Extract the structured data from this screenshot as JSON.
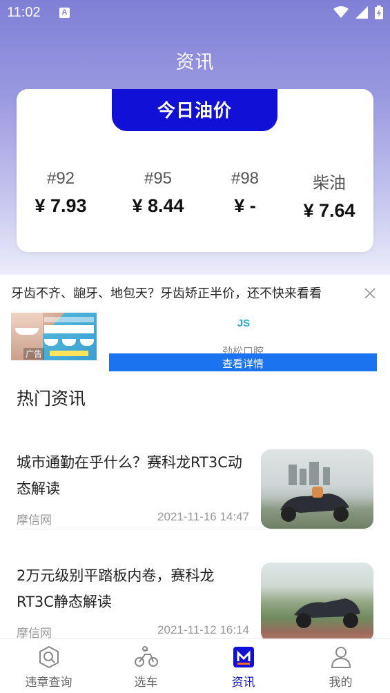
{
  "status_bar": {
    "time": "11:02",
    "notification_badge": "A"
  },
  "page_title": "资讯",
  "oil_prices": {
    "heading": "今日油价",
    "items": [
      {
        "grade": "#92",
        "price": "¥ 7.93"
      },
      {
        "grade": "#95",
        "price": "¥ 8.44"
      },
      {
        "grade": "#98",
        "price": "¥ -"
      },
      {
        "grade": "柴油",
        "price": "¥ 7.64"
      }
    ]
  },
  "ad": {
    "text": "牙齿不齐、龅牙、地包天？牙齿矫正半价，还不快来看看",
    "label": "广告",
    "brand": "劲松口腔",
    "logo_text": "JS",
    "button": "查看详情"
  },
  "hot_news": {
    "title": "热门资讯",
    "items": [
      {
        "title": "城市通勤在乎什么？赛科龙RT3C动态解读",
        "source": "摩信网",
        "date": "2021-11-16 14:47"
      },
      {
        "title": "2万元级别平踏板内卷，赛科龙RT3C静态解读",
        "source": "摩信网",
        "date": "2021-11-12 16:14"
      }
    ]
  },
  "tabbar": {
    "items": [
      {
        "label": "违章查询",
        "icon": "search-violation-icon"
      },
      {
        "label": "选车",
        "icon": "motorcycle-icon"
      },
      {
        "label": "资讯",
        "icon": "news-icon"
      },
      {
        "label": "我的",
        "icon": "profile-icon"
      }
    ],
    "active_index": 2,
    "accent_color": "#1010d6"
  }
}
